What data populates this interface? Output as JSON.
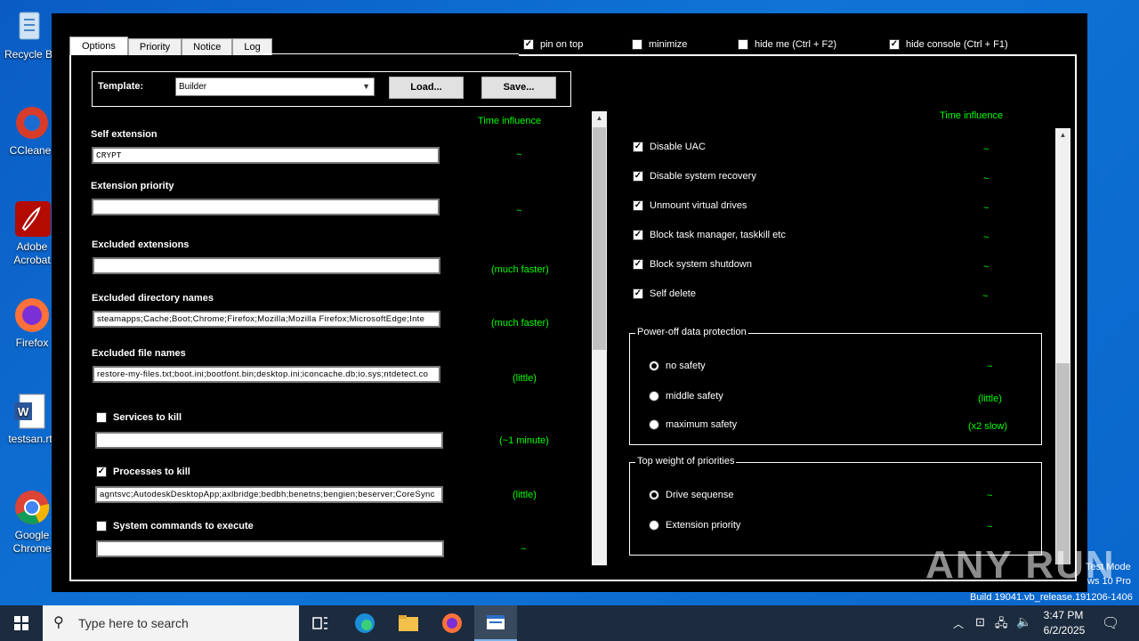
{
  "desktop": {
    "icons": [
      {
        "label": "Recycle Bin",
        "lines": [
          "Recycle B"
        ]
      },
      {
        "label": "CCleaner",
        "lines": [
          "CCleane"
        ]
      },
      {
        "label": "Adobe Acrobat",
        "lines": [
          "Adobe",
          "Acrobat"
        ]
      },
      {
        "label": "Firefox",
        "lines": [
          "Firefox"
        ]
      },
      {
        "label": "testsan.rtf",
        "lines": [
          "testsan.rt"
        ]
      },
      {
        "label": "Google Chrome",
        "lines": [
          "Google",
          "Chrome"
        ]
      }
    ]
  },
  "window": {
    "tabs": [
      "Options",
      "Priority",
      "Notice",
      "Log"
    ],
    "active_tab": "Options",
    "top_options": [
      {
        "label": "pin on top",
        "checked": true
      },
      {
        "label": "minimize",
        "checked": false
      },
      {
        "label": "hide me (Ctrl + F2)",
        "checked": false
      },
      {
        "label": "hide console (Ctrl + F1)",
        "checked": true
      }
    ],
    "template": {
      "label": "Template:",
      "selected": "Builder",
      "load_label": "Load...",
      "save_label": "Save..."
    },
    "left": {
      "time_influence_header": "Time influence",
      "self_extension": {
        "label": "Self extension",
        "value": "CRYPT",
        "influence": "~"
      },
      "extension_priority": {
        "label": "Extension priority",
        "value": "",
        "influence": "~"
      },
      "excluded_extensions": {
        "label": "Excluded extensions",
        "value": "",
        "influence": "(much faster)"
      },
      "excluded_dirs": {
        "label": "Excluded directory names",
        "value": "steamapps;Cache;Boot;Chrome;Firefox;Mozilla;Mozilla Firefox;MicrosoftEdge;Inte",
        "influence": "(much faster)"
      },
      "excluded_files": {
        "label": "Excluded file names",
        "value": "restore-my-files.txt;boot.ini;bootfont.bin;desktop.ini;iconcache.db;io.sys;ntdetect.co",
        "influence": "(little)"
      },
      "services_to_kill": {
        "label": "Services to kill",
        "checked": false,
        "value": "",
        "influence": "(~1 minute)"
      },
      "processes_to_kill": {
        "label": "Processes to kill",
        "checked": true,
        "value": "agntsvc;AutodeskDesktopApp;axlbridge;bedbh;benetns;bengien;beserver;CoreSync",
        "influence": "(little)"
      },
      "system_commands": {
        "label": "System commands to execute",
        "checked": false,
        "value": "",
        "influence": "~"
      }
    },
    "right": {
      "time_influence_header": "Time influence",
      "options": [
        {
          "label": "Disable UAC",
          "checked": true,
          "influence": "~"
        },
        {
          "label": "Disable system recovery",
          "checked": true,
          "influence": "~"
        },
        {
          "label": "Unmount virtual drives",
          "checked": true,
          "influence": "~"
        },
        {
          "label": "Block task manager, taskkill etc",
          "checked": true,
          "influence": "~"
        },
        {
          "label": "Block system shutdown",
          "checked": true,
          "influence": "~"
        },
        {
          "label": "Self delete",
          "checked": true,
          "influence": "~"
        }
      ],
      "power_off": {
        "title": "Power-off data protection",
        "options": [
          {
            "label": "no safety",
            "selected": true,
            "influence": "~"
          },
          {
            "label": "middle safety",
            "selected": false,
            "influence": "(little)"
          },
          {
            "label": "maximum safety",
            "selected": false,
            "influence": "(x2 slow)"
          }
        ]
      },
      "top_weight": {
        "title": "Top weight of priorities",
        "options": [
          {
            "label": "Drive sequense",
            "selected": true,
            "influence": "~"
          },
          {
            "label": "Extension priority",
            "selected": false,
            "influence": "~"
          }
        ]
      }
    }
  },
  "watermark": {
    "brand": "ANY RUN",
    "line1": "Test Mode",
    "line2": "ws 10 Pro",
    "line3": "Build 19041.vb_release.191206-1406"
  },
  "taskbar": {
    "search_placeholder": "Type here to search",
    "time": "3:47 PM",
    "date": "6/2/2025"
  },
  "colors": {
    "desktop": "#0a66cc",
    "window_bg": "#000000",
    "influence_text": "#00ff00",
    "taskbar": "#1c2b3e"
  }
}
